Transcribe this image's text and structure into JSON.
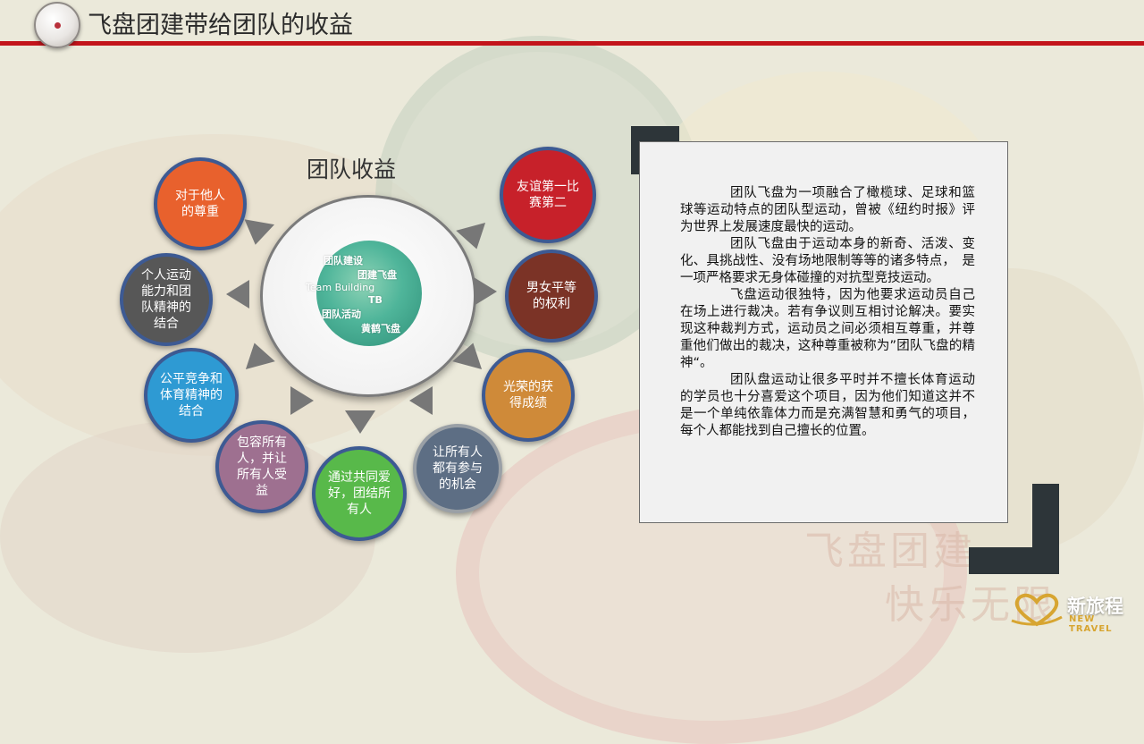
{
  "header": {
    "title": "飞盘团建带给团队的收益"
  },
  "diagram": {
    "center_label": "团队收益",
    "center_image_lines": [
      "团队建设",
      "团建飞盘",
      "Team Building",
      "TB",
      "团队活动",
      "黄鹤飞盘"
    ],
    "items": [
      {
        "text": "对于他人的尊重",
        "color": "#e8612d"
      },
      {
        "text": "友谊第一比赛第二",
        "color": "#c7212a"
      },
      {
        "text": "男女平等的权利",
        "color": "#7b3326"
      },
      {
        "text": "光荣的获得成绩",
        "color": "#cf8a39"
      },
      {
        "text": "让所有人都有参与的机会",
        "color": "#5d6e84"
      },
      {
        "text": "通过共同爱好，团结所有人",
        "color": "#58b94a"
      },
      {
        "text": "包容所有人，并让所有人受益",
        "color": "#9e7090"
      },
      {
        "text": "公平竞争和体育精神的结合",
        "color": "#2e9ad3"
      },
      {
        "text": "个人运动能力和团队精神的结合",
        "color": "#575757"
      }
    ]
  },
  "panel": {
    "paragraphs": [
      "团队飞盘为一项融合了橄榄球、足球和篮球等运动特点的团队型运动，曾被《纽约时报》评为世界上发展速度最快的运动。",
      "团队飞盘由于运动本身的新奇、活泼、变化、具挑战性、没有场地限制等等的诸多特点，　是一项严格要求无身体碰撞的对抗型竞技运动。",
      "飞盘运动很独特，因为他要求运动员自己在场上进行裁决。若有争议则互相讨论解决。要实现这种裁判方式，运动员之间必须相互尊重，并尊重他们做出的裁决，这种尊重被称为”团队飞盘的精神“。",
      "团队盘运动让很多平时并不擅长体育运动的学员也十分喜爱这个项目，因为他们知道这并不是一个单纯依靠体力而是充满智慧和勇气的项目，每个人都能找到自己擅长的位置。"
    ]
  },
  "watermark": {
    "line1": "飞盘团建",
    "line2": "快乐无限"
  },
  "logo": {
    "cn": "新旅程",
    "en": "NEW TRAVEL",
    "icon": "heart-logo-icon"
  }
}
